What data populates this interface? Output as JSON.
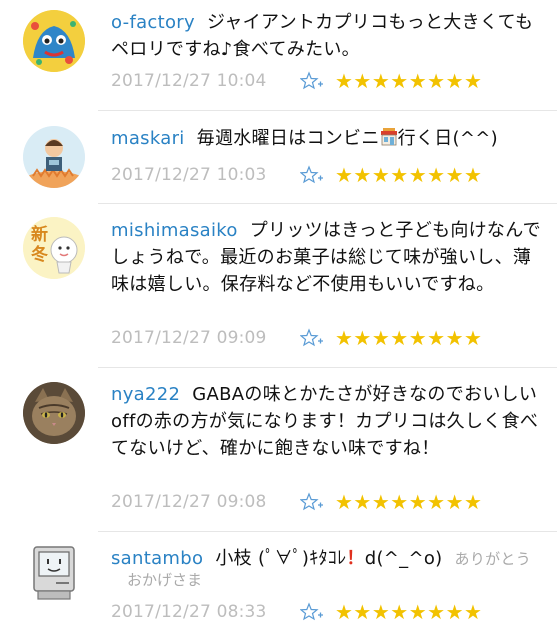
{
  "comments": [
    {
      "username": "o-factory",
      "text": "ジャイアントカプリコもっと大きくてもペロリですね♪食べてみたい。",
      "timestamp": "2017/12/27 10:04",
      "stars": "★★★★★★★★",
      "avatar_icon": "avatar-blue-character-icon"
    },
    {
      "username": "maskari",
      "text_before": "毎週水曜日はコンビニ",
      "text_after": "行く日(^^)",
      "timestamp": "2017/12/27 10:03",
      "stars": "★★★★★★★★",
      "avatar_icon": "avatar-person-icon"
    },
    {
      "username": "mishimasaiko",
      "text": "プリッツはきっと子ども向けなんでしょうねで。最近のお菓子は総じて味が強いし、薄味は嬉しい。保存料など不使用もいいですね。",
      "timestamp": "2017/12/27 09:09",
      "stars": "★★★★★★★★",
      "avatar_text": "新冬"
    },
    {
      "username": "nya222",
      "text": "GABAの味とかたさが好きなのでおいしいoffの赤の方が気になります！カプリコは久しく食べてないけど、確かに飽きない味ですね！",
      "timestamp": "2017/12/27 09:08",
      "stars": "★★★★★★★★",
      "avatar_icon": "avatar-cat-icon"
    },
    {
      "username": "santambo",
      "text_before": "小枝 (ﾟ∀ﾟ)ｷﾀｺﾚ",
      "text_mid": "！",
      "text_after": "d(^_^o)",
      "sub_line1": "ありがとう",
      "sub_line2": "おかげさま",
      "timestamp": "2017/12/27 08:33",
      "stars": "★★★★★★★★",
      "avatar_icon": "avatar-computer-icon"
    }
  ],
  "colors": {
    "username": "#2a82c4",
    "timestamp": "#bdbdbd",
    "star": "#f2c200",
    "add_star": "#5a9bd5"
  }
}
